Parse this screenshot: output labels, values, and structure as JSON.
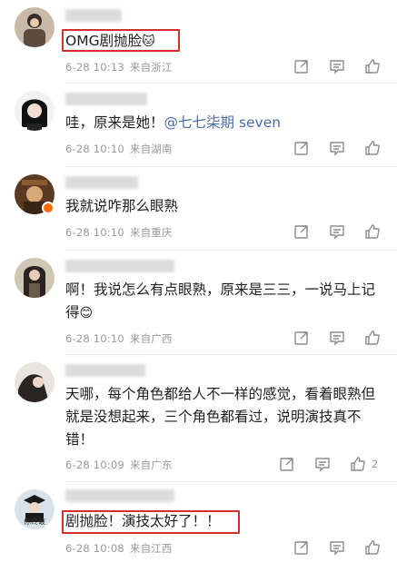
{
  "comments": [
    {
      "username": "████████",
      "text": "OMG剧抛脸",
      "emoji": "🐱",
      "date": "6-28 10:13",
      "location": "来自浙江",
      "likes": ""
    },
    {
      "username": "████████████",
      "text": "哇，原来是她！",
      "mention": "@七七柒期 seven",
      "date": "6-28 10:10",
      "location": "来自湖南",
      "likes": ""
    },
    {
      "username": "██████████",
      "text": "我就说咋那么眼熟",
      "date": "6-28 10:10",
      "location": "来自重庆",
      "likes": ""
    },
    {
      "username": "████████████████",
      "text": "啊！我说怎么有点眼熟，原来是三三，一说马上记得",
      "emoji": "😊",
      "date": "6-28 10:10",
      "location": "来自广西",
      "likes": ""
    },
    {
      "username": "███████████",
      "text": "天哪，每个角色都给人不一样的感觉，看着眼熟但就是没想起来，三个角色都看过，说明演技真不错！",
      "date": "6-28 10:09",
      "location": "来自广东",
      "likes": "2"
    },
    {
      "username": "████████████████",
      "avatar_caption": "你终破",
      "text": "剧抛脸！演技太好了！！",
      "date": "6-28 10:08",
      "location": "来自江西",
      "likes": ""
    }
  ],
  "icons": [
    "share-icon",
    "comment-icon",
    "like-icon"
  ],
  "colors": {
    "highlight": "#d62d2d",
    "mention": "#4a6fa5",
    "meta": "#9a9a9a",
    "vip_badge": "#ff6a00"
  }
}
